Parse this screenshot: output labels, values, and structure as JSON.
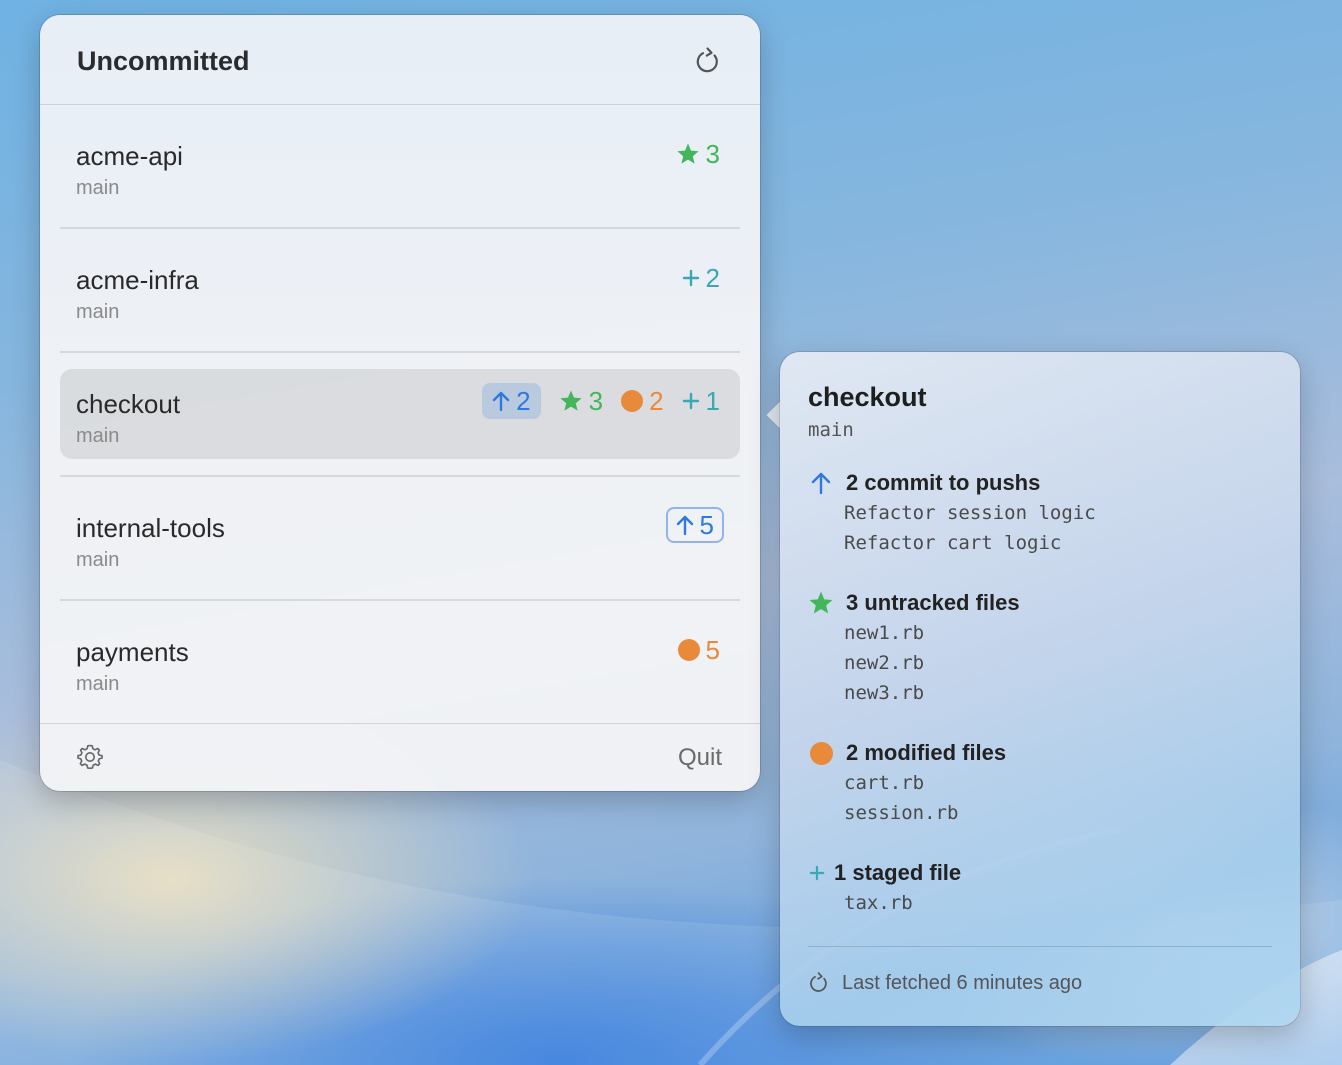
{
  "panel": {
    "title": "Uncommitted",
    "footer": {
      "quit_label": "Quit"
    }
  },
  "repos": [
    {
      "name": "acme-api",
      "branch": "main",
      "untracked": "3"
    },
    {
      "name": "acme-infra",
      "branch": "main",
      "staged": "2"
    },
    {
      "name": "checkout",
      "branch": "main",
      "push": "2",
      "untracked": "3",
      "modified": "2",
      "staged": "1",
      "selected": true
    },
    {
      "name": "internal-tools",
      "branch": "main",
      "push": "5"
    },
    {
      "name": "payments",
      "branch": "main",
      "modified": "5"
    }
  ],
  "detail": {
    "title": "checkout",
    "branch": "main",
    "push": {
      "heading": "2 commit to pushs",
      "items": [
        "Refactor session logic",
        "Refactor cart logic"
      ]
    },
    "untracked": {
      "heading": "3 untracked files",
      "items": [
        "new1.rb",
        "new2.rb",
        "new3.rb"
      ]
    },
    "modified": {
      "heading": "2 modified files",
      "items": [
        "cart.rb",
        "session.rb"
      ]
    },
    "staged": {
      "heading": "1 staged file",
      "items": [
        "tax.rb"
      ]
    },
    "footer": "Last fetched 6 minutes ago"
  },
  "colors": {
    "push": "#2f78e0",
    "untracked": "#43b55a",
    "modified": "#e88a3a",
    "staged": "#38a8b5"
  },
  "icons": [
    "refresh-icon",
    "gear-icon",
    "arrow-up-icon",
    "star-icon",
    "dot-icon",
    "plus-icon"
  ]
}
